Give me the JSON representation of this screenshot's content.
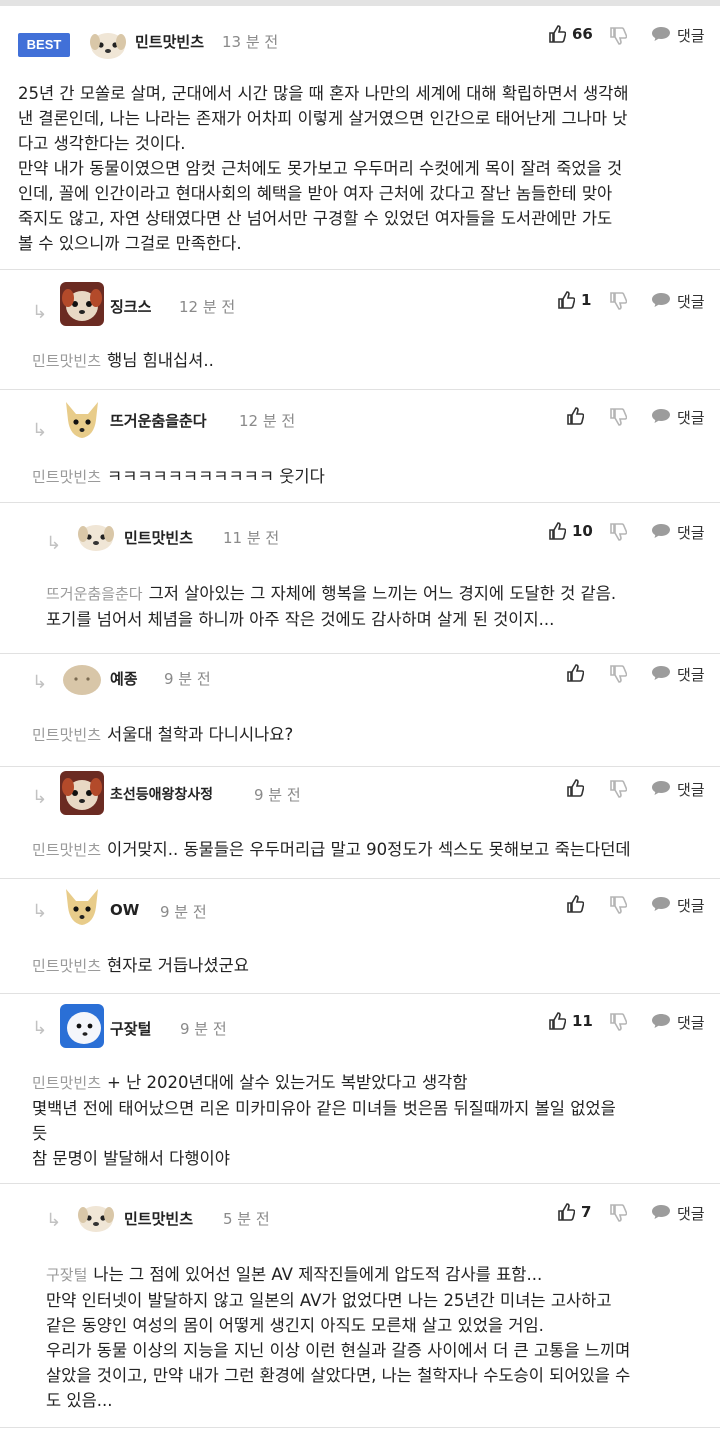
{
  "badge": "BEST",
  "comments": [
    {
      "nick": "민트맛빈츠",
      "time": "13 분 전",
      "likes": "66",
      "reply": "댓글",
      "lines": [
        "25년 간 모쏠로 살며, 군대에서 시간 많을 때 혼자 나만의 세계에 대해 확립하면서 생각해",
        "낸 결론인데, 나는 나라는 존재가 어차피 이렇게 살거였으면 인간으로 태어난게 그나마 낫",
        "다고 생각한다는 것이다.",
        "만약 내가 동물이였으면 암컷 근처에도 못가보고 우두머리 수컷에게 목이 잘려 죽었을 것",
        "인데, 꼴에 인간이라고 현대사회의 혜택을 받아 여자 근처에 갔다고 잘난 놈들한테 맞아",
        "죽지도 않고, 자연 상태였다면 산 넘어서만 구경할 수 있었던 여자들을 도서관에만 가도",
        "볼 수 있으니까 그걸로 만족한다."
      ]
    },
    {
      "nick": "징크스",
      "time": "12 분 전",
      "likes": "1",
      "reply": "댓글",
      "mention": "민트맛빈츠",
      "lines": [
        "행님 힘내십셔.."
      ]
    },
    {
      "nick": "뜨거운춤을춘다",
      "time": "12 분 전",
      "likes": "",
      "reply": "댓글",
      "mention": "민트맛빈츠",
      "lines": [
        "ㅋㅋㅋㅋㅋㅋㅋㅋㅋㅋㅋ 웃기다"
      ]
    },
    {
      "nick": "민트맛빈츠",
      "time": "11 분 전",
      "likes": "10",
      "reply": "댓글",
      "mention": "뜨거운춤을춘다",
      "lines": [
        "그저 살아있는 그 자체에 행복을 느끼는 어느 경지에 도달한 것 같음.",
        "포기를 넘어서 체념을 하니까 아주 작은 것에도 감사하며 살게 된 것이지..."
      ]
    },
    {
      "nick": "예종",
      "time": "9 분 전",
      "likes": "",
      "reply": "댓글",
      "mention": "민트맛빈츠",
      "lines": [
        "서울대 철학과 다니시나요?"
      ]
    },
    {
      "nick": "초선등애왕창사정",
      "time": "9 분 전",
      "likes": "",
      "reply": "댓글",
      "mention": "민트맛빈츠",
      "lines": [
        "이거맞지.. 동물들은 우두머리급 말고 90정도가 섹스도 못해보고 죽는다던데"
      ]
    },
    {
      "nick": "OW",
      "time": "9 분 전",
      "likes": "",
      "reply": "댓글",
      "mention": "민트맛빈츠",
      "lines": [
        "현자로 거듭나셨군요"
      ]
    },
    {
      "nick": "구잦털",
      "time": "9 분 전",
      "likes": "11",
      "reply": "댓글",
      "mention": "민트맛빈츠",
      "lines": [
        "+ 난 2020년대에 살수 있는거도 복받았다고 생각함",
        "몇백년 전에 태어났으면 리온 미카미유아 같은 미녀들 벗은몸 뒤질때까지 볼일 없었을",
        "듯",
        "참 문명이 발달해서 다행이야"
      ]
    },
    {
      "nick": "민트맛빈츠",
      "time": "5 분 전",
      "likes": "7",
      "reply": "댓글",
      "mention": "구잦털",
      "lines": [
        "나는 그 점에 있어선 일본 AV 제작진들에게 압도적 감사를 표함...",
        "만약 인터넷이 발달하지 않고 일본의 AV가 없었다면 나는 25년간 미녀는 고사하고",
        "같은 동양인 여성의 몸이 어떻게 생긴지 아직도 모른채 살고 있었을 거임.",
        "우리가 동물 이상의 지능을 지닌 이상 이런 현실과 갈증 사이에서 더 큰 고통을 느끼며",
        "살았을 것이고, 만약 내가 그런 환경에 살았다면, 나는 철학자나 수도승이 되어있을 수",
        "도 있음..."
      ]
    }
  ]
}
